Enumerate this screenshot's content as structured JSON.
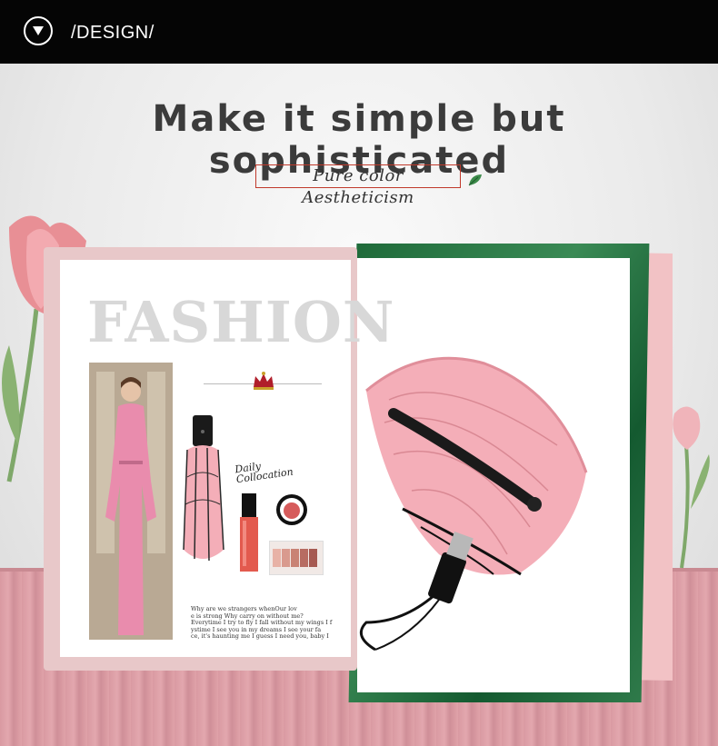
{
  "header": {
    "title": "/DESIGN/",
    "icon": "chevron-down-circle-icon"
  },
  "headline": "Make it simple but sophisticated",
  "subtitle": "Pure color Aestheticism",
  "magazine": {
    "heading": "FASHION",
    "daily_line1": "Daily",
    "daily_line2": "Collocation",
    "body_text": [
      "Why are we strangers whenOur lov",
      "e is strong Why carry on without me?",
      "Everytime I try to fly I fall without my wings I f",
      "ystime I see you in my dreams I see your fa",
      "ce, it's haunting me I guess I need you, baby I"
    ]
  },
  "colors": {
    "header_bg": "#050505",
    "umbrella_pink": "#f4aeb8",
    "floor_pink": "#d99aa2",
    "subtitle_border": "#c0392b"
  }
}
